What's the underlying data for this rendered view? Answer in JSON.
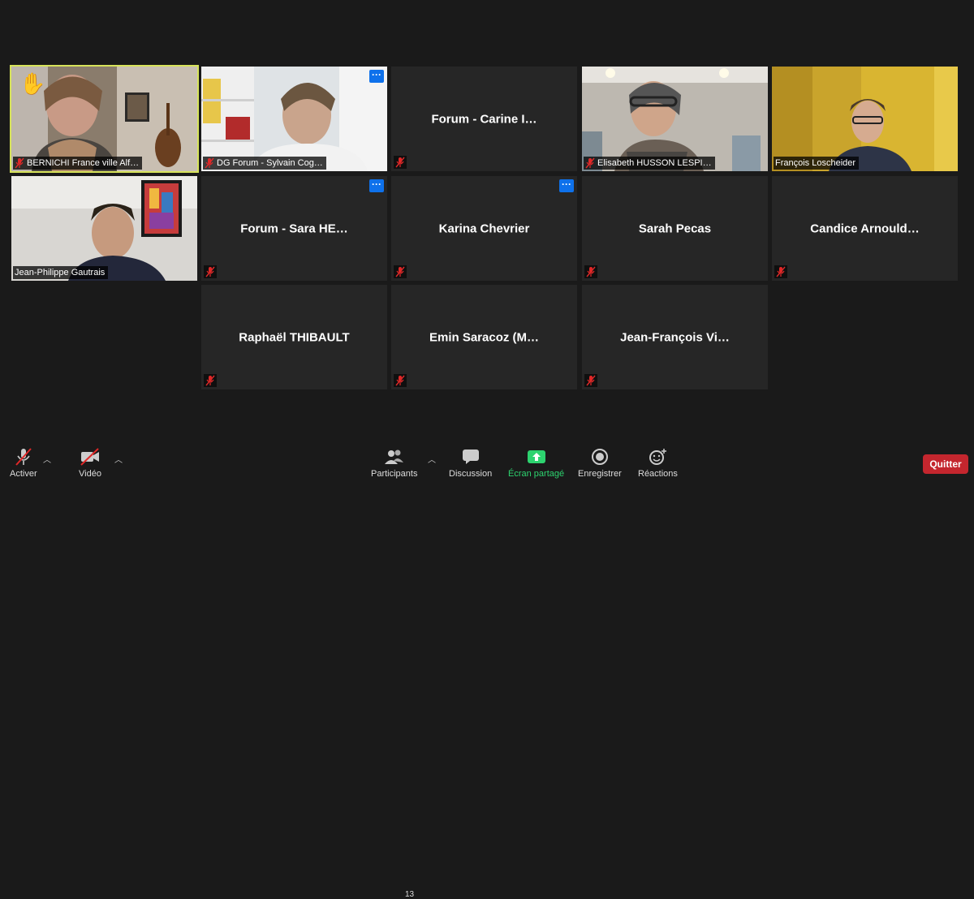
{
  "participants": [
    {
      "name_label": "BERNICHI France ville Alf…",
      "type": "video",
      "raised_hand": true,
      "active_speaker": true,
      "muted": true
    },
    {
      "name_label": "DG Forum - Sylvain Cog…",
      "type": "video",
      "more_button": true,
      "muted": true
    },
    {
      "center_name": "Forum - Carine I…",
      "type": "avatar",
      "muted": true
    },
    {
      "name_label": "Elisabeth HUSSON LESPI…",
      "type": "video",
      "muted": true
    },
    {
      "name_label": "François Loscheider",
      "type": "video",
      "muted": false
    },
    {
      "name_label": "Jean-Philippe Gautrais",
      "type": "video",
      "muted": false
    },
    {
      "center_name": "Forum - Sara HE…",
      "type": "avatar",
      "more_button": true,
      "muted": true
    },
    {
      "center_name": "Karina Chevrier",
      "type": "avatar",
      "more_button": true,
      "muted": true
    },
    {
      "center_name": "Sarah Pecas",
      "type": "avatar",
      "muted": true
    },
    {
      "center_name": "Candice Arnould…",
      "type": "avatar",
      "muted": true
    },
    {
      "center_name": "Raphaël THIBAULT",
      "type": "avatar",
      "muted": true
    },
    {
      "center_name": "Emin Saracoz (M…",
      "type": "avatar",
      "muted": true
    },
    {
      "center_name": "Jean-François Vi…",
      "type": "avatar",
      "muted": true
    }
  ],
  "more_glyph": "···",
  "hand_glyph": "✋",
  "toolbar": {
    "unmute_label": "Activer",
    "video_label": "Vidéo",
    "participants_label": "Participants",
    "participants_count": "13",
    "chat_label": "Discussion",
    "share_label": "Écran partagé",
    "record_label": "Enregistrer",
    "reactions_label": "Réactions",
    "quit_label": "Quitter"
  },
  "colors": {
    "active_speaker_border": "#d7e35a",
    "share_green": "#2dd36f",
    "quit_red": "#c4262e",
    "more_blue": "#0e71eb",
    "mute_red": "#e02828"
  }
}
